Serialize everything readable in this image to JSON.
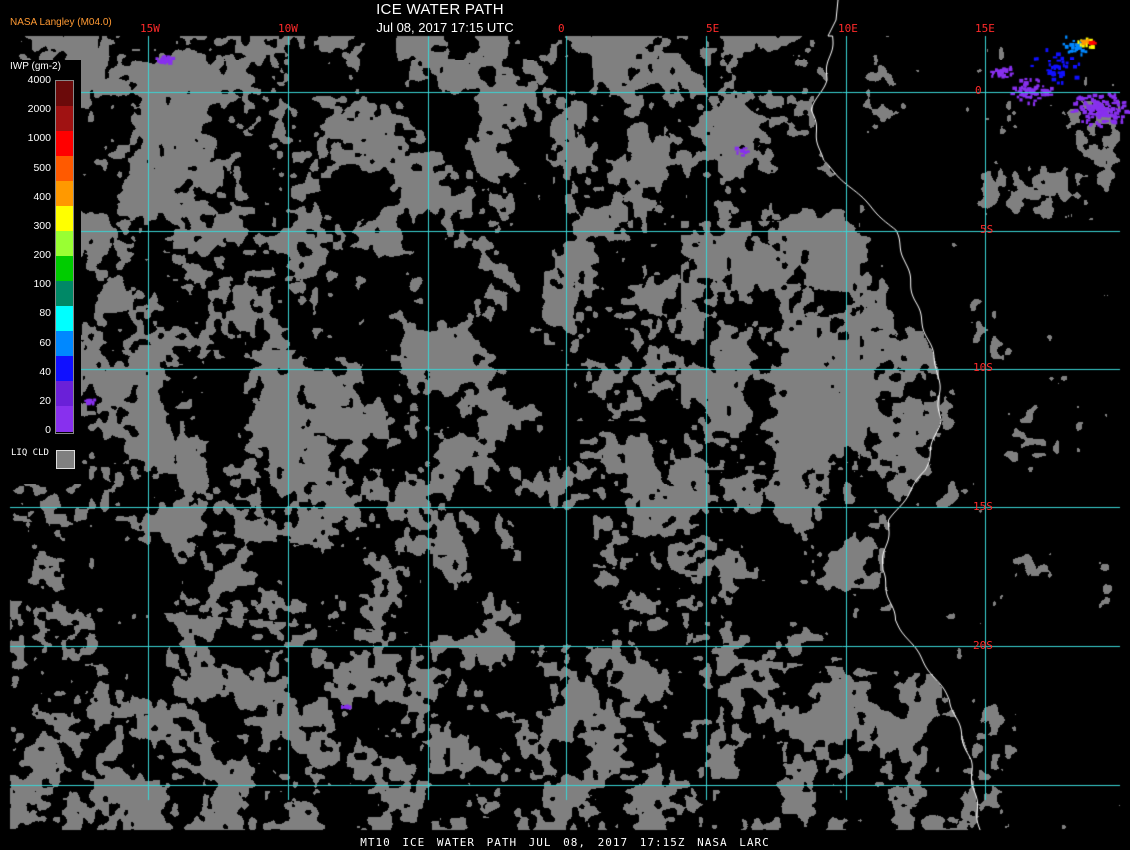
{
  "product": {
    "title": "ICE WATER PATH",
    "datetime": "Jul 08, 2017 17:15 UTC",
    "credit": "NASA Langley (M04.0)",
    "footer": "MT10  ICE WATER PATH  JUL 08, 2017 17:15Z  NASA LARC"
  },
  "grid": {
    "longitude_labels": [
      "15W",
      "10W",
      "0",
      "5E",
      "10E",
      "15E"
    ],
    "latitude_labels": [
      "0",
      "5S",
      "10S",
      "15S",
      "20S"
    ],
    "line_color": "#3ad6d6",
    "label_color": "#ff2a2a"
  },
  "legend": {
    "title": "IWP (gm-2)",
    "levels": [
      "4000",
      "2000",
      "1000",
      "500",
      "400",
      "300",
      "200",
      "100",
      "80",
      "60",
      "40",
      "20",
      "0"
    ],
    "colors": [
      "#6b0a0a",
      "#a01212",
      "#ff0000",
      "#ff5a00",
      "#ff9900",
      "#ffff00",
      "#99ff33",
      "#00cc00",
      "#008866",
      "#00ffff",
      "#0088ff",
      "#1010ff",
      "#6a20d8",
      "#8830ee"
    ],
    "liquid_cloud_label": "LIQ CLD",
    "liquid_cloud_color": "#808080"
  },
  "colors": {
    "background": "#000000",
    "liquid_cloud": "#808080",
    "coastline": "#ffffff"
  }
}
